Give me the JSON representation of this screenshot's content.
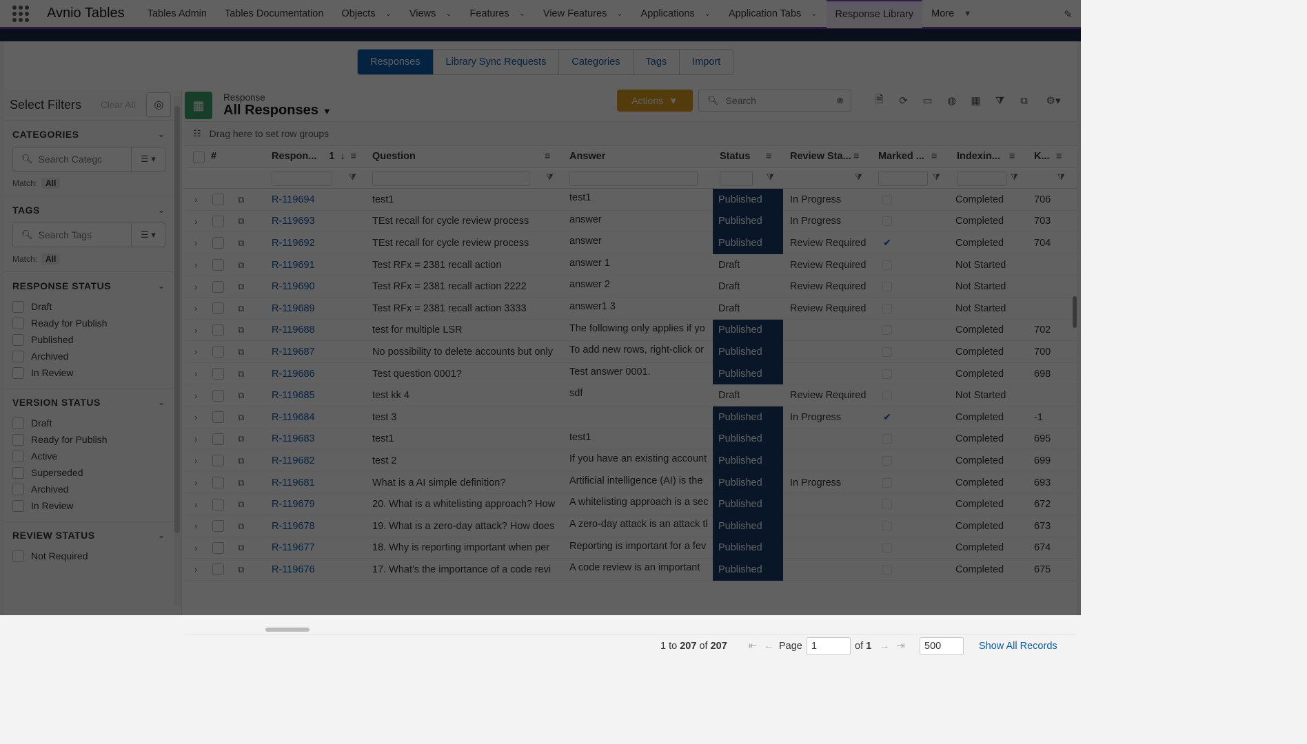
{
  "nav": {
    "app_name": "Avnio Tables",
    "items": [
      {
        "label": "Tables Admin",
        "dropdown": false
      },
      {
        "label": "Tables Documentation",
        "dropdown": false
      },
      {
        "label": "Objects",
        "dropdown": true
      },
      {
        "label": "Views",
        "dropdown": true
      },
      {
        "label": "Features",
        "dropdown": true
      },
      {
        "label": "View Features",
        "dropdown": true
      },
      {
        "label": "Applications",
        "dropdown": true
      },
      {
        "label": "Application Tabs",
        "dropdown": true
      },
      {
        "label": "Response Library",
        "dropdown": false,
        "active": true
      },
      {
        "label": "More",
        "dropdown": true
      }
    ]
  },
  "tabs": [
    "Responses",
    "Library Sync Requests",
    "Categories",
    "Tags",
    "Import"
  ],
  "filters": {
    "title": "Select Filters",
    "clear_all": "Clear All",
    "match_label": "Match:",
    "match_value": "All",
    "categories": {
      "title": "CATEGORIES",
      "placeholder": "Search Categc"
    },
    "tags": {
      "title": "TAGS",
      "placeholder": "Search Tags"
    },
    "response_status": {
      "title": "RESPONSE STATUS",
      "options": [
        "Draft",
        "Ready for Publish",
        "Published",
        "Archived",
        "In Review"
      ]
    },
    "version_status": {
      "title": "VERSION STATUS",
      "options": [
        "Draft",
        "Ready for Publish",
        "Active",
        "Superseded",
        "Archived",
        "In Review"
      ]
    },
    "review_status": {
      "title": "REVIEW STATUS",
      "options": [
        "Not Required"
      ]
    }
  },
  "grid": {
    "object_label": "Response",
    "view_name": "All Responses",
    "actions_label": "Actions",
    "search_placeholder": "Search",
    "drag_hint": "Drag here to set row groups",
    "columns": {
      "hash": "#",
      "response": "Respon...",
      "sort_index": "1",
      "question": "Question",
      "answer": "Answer",
      "status": "Status",
      "review": "Review Sta...",
      "marked": "Marked ...",
      "indexing": "Indexin...",
      "k": "K..."
    },
    "rows": [
      {
        "id": "R-119694",
        "question": "test1",
        "answer": "test1",
        "status": "Published",
        "review": "In Progress",
        "marked": false,
        "indexing": "Completed",
        "k": "706"
      },
      {
        "id": "R-119693",
        "question": "TEst recall for cycle review process",
        "answer": "answer",
        "status": "Published",
        "review": "In Progress",
        "marked": false,
        "indexing": "Completed",
        "k": "703"
      },
      {
        "id": "R-119692",
        "question": "TEst recall for cycle review process",
        "answer": "answer",
        "status": "Published",
        "review": "Review Required",
        "marked": true,
        "indexing": "Completed",
        "k": "704"
      },
      {
        "id": "R-119691",
        "question": "Test RFx = 2381 recall action",
        "answer": "answer 1",
        "status": "Draft",
        "review": "Review Required",
        "marked": false,
        "indexing": "Not Started",
        "k": ""
      },
      {
        "id": "R-119690",
        "question": "Test RFx = 2381 recall action 2222",
        "answer": "answer 2",
        "status": "Draft",
        "review": "Review Required",
        "marked": false,
        "indexing": "Not Started",
        "k": ""
      },
      {
        "id": "R-119689",
        "question": "Test RFx = 2381 recall action 3333",
        "answer": "answer1 3",
        "status": "Draft",
        "review": "Review Required",
        "marked": false,
        "indexing": "Not Started",
        "k": ""
      },
      {
        "id": "R-119688",
        "question": "test for multiple LSR",
        "answer": "The following only applies if yo",
        "status": "Published",
        "review": "",
        "marked": false,
        "indexing": "Completed",
        "k": "702"
      },
      {
        "id": "R-119687",
        "question": "No possibility to delete accounts but only",
        "answer": "To add new rows, right-click or",
        "status": "Published",
        "review": "",
        "marked": false,
        "indexing": "Completed",
        "k": "700"
      },
      {
        "id": "R-119686",
        "question": "Test question 0001?",
        "answer": "Test answer 0001.",
        "status": "Published",
        "review": "",
        "marked": false,
        "indexing": "Completed",
        "k": "698"
      },
      {
        "id": "R-119685",
        "question": "test kk 4",
        "answer": "sdf",
        "status": "Draft",
        "review": "Review Required",
        "marked": false,
        "indexing": "Not Started",
        "k": ""
      },
      {
        "id": "R-119684",
        "question": "test 3",
        "answer": "",
        "status": "Published",
        "review": "In Progress",
        "marked": true,
        "indexing": "Completed",
        "k": "-1"
      },
      {
        "id": "R-119683",
        "question": "test1",
        "answer": "test1",
        "status": "Published",
        "review": "",
        "marked": false,
        "indexing": "Completed",
        "k": "695"
      },
      {
        "id": "R-119682",
        "question": "test 2",
        "answer": "If you have an existing account",
        "status": "Published",
        "review": "",
        "marked": false,
        "indexing": "Completed",
        "k": "699"
      },
      {
        "id": "R-119681",
        "question": "What is a AI simple definition?",
        "answer": "Artificial intelligence (AI) is the",
        "status": "Published",
        "review": "In Progress",
        "marked": false,
        "indexing": "Completed",
        "k": "693"
      },
      {
        "id": "R-119679",
        "question": "20. What is a whitelisting approach? How",
        "answer": "A whitelisting approach is a sec",
        "status": "Published",
        "review": "",
        "marked": false,
        "indexing": "Completed",
        "k": "672"
      },
      {
        "id": "R-119678",
        "question": "19. What is a zero-day attack? How does",
        "answer": "A zero-day attack is an attack tl",
        "status": "Published",
        "review": "",
        "marked": false,
        "indexing": "Completed",
        "k": "673"
      },
      {
        "id": "R-119677",
        "question": "18. Why is reporting important when per",
        "answer": "Reporting is important for a fev",
        "status": "Published",
        "review": "",
        "marked": false,
        "indexing": "Completed",
        "k": "674"
      },
      {
        "id": "R-119676",
        "question": "17. What's the importance of a code revi",
        "answer": "A code review is an important",
        "status": "Published",
        "review": "",
        "marked": false,
        "indexing": "Completed",
        "k": "675"
      }
    ],
    "footer": {
      "range_from": "1",
      "range_to_label": "to",
      "range_to": "207",
      "of_label": "of",
      "total": "207",
      "page_label": "Page",
      "page_value": "1",
      "page_of_label": "of",
      "page_count": "1",
      "page_size": "500",
      "show_all": "Show All Records"
    }
  }
}
